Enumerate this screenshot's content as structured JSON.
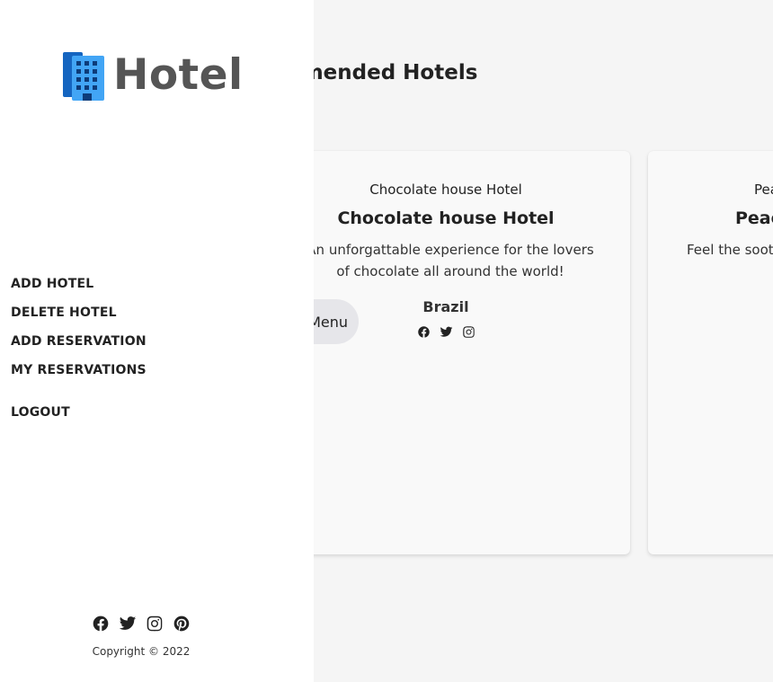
{
  "header": {
    "title": "Recommended Hotels"
  },
  "sidebar": {
    "logo_text": "Hotel",
    "logo_icon": "building-icon",
    "nav": [
      {
        "label": "ADD HOTEL"
      },
      {
        "label": "DELETE HOTEL"
      },
      {
        "label": "ADD RESERVATION"
      },
      {
        "label": "MY RESERVATIONS"
      }
    ],
    "logout_label": "LOGOUT",
    "social_icons": [
      "facebook-icon",
      "twitter-icon",
      "instagram-icon",
      "pinterest-icon"
    ],
    "copyright": "Copyright © 2022"
  },
  "hotels": [
    {
      "subname": "Chocolate house Hotel",
      "name": "Chocolate house Hotel",
      "description": "An unforgattable experience for the lovers of chocolate all around the world!",
      "location": "Brazil",
      "menu_label": "Menu",
      "social_icons": [
        "facebook-icon",
        "twitter-icon",
        "instagram-icon"
      ]
    },
    {
      "subname": "Pea",
      "name": "Peac",
      "description": "Feel the sooth relax"
    }
  ],
  "colors": {
    "sidebar_bg": "#ffffff",
    "page_bg": "#f5f5f5",
    "card_bg": "#f9f9f9",
    "menu_button_bg": "#e6e6ea",
    "logo_icon_blue": "#1e88e5",
    "logo_text": "#555555"
  }
}
